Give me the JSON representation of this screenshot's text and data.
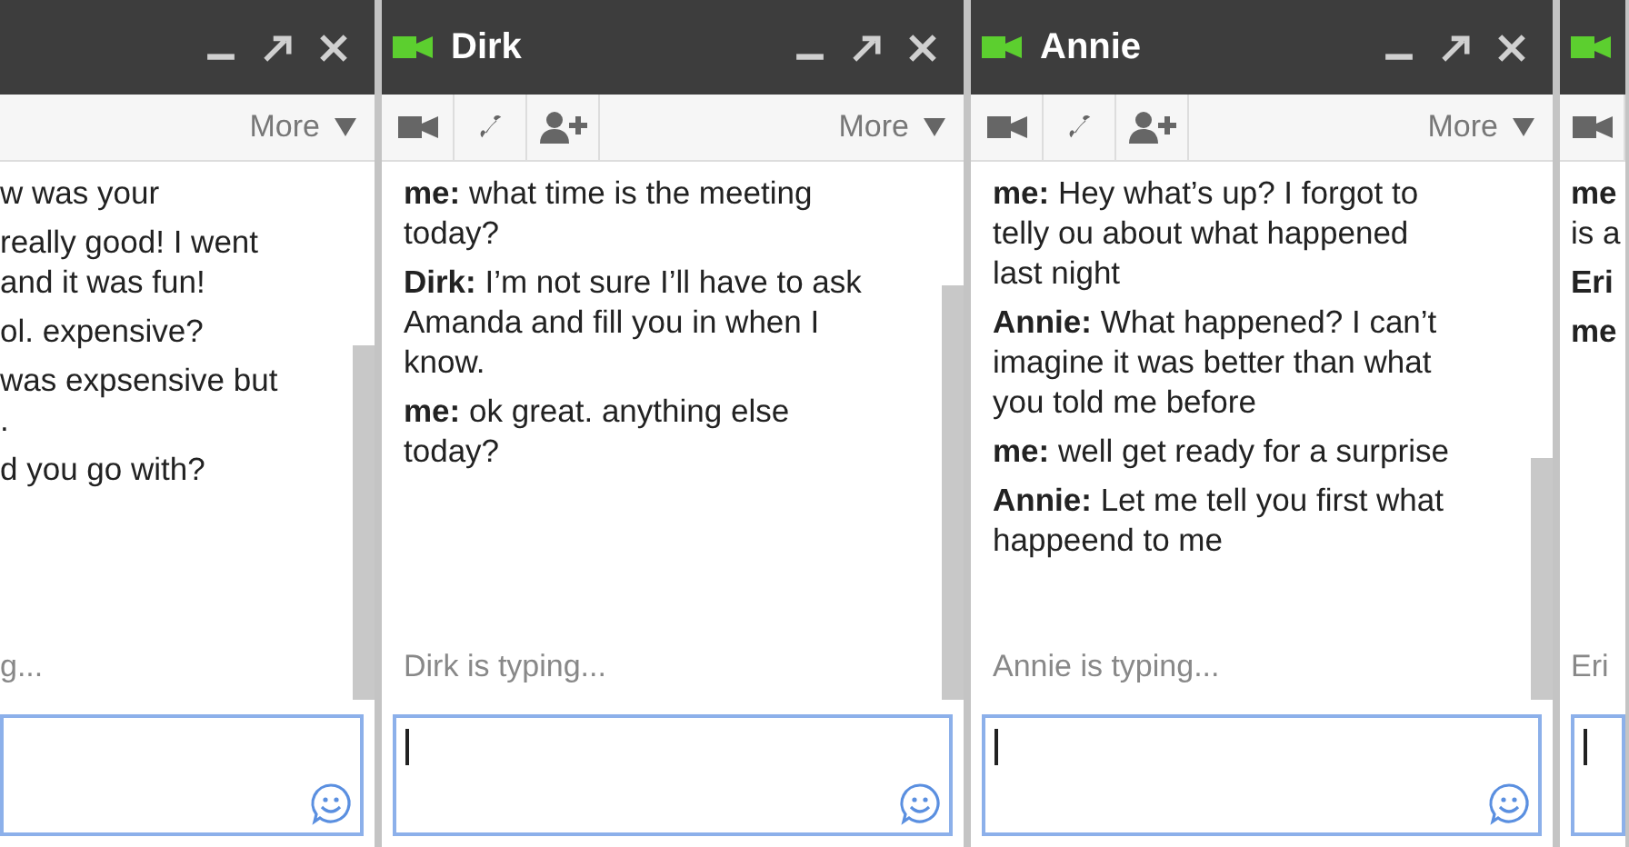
{
  "chat_windows": [
    {
      "more": "More",
      "messages": [
        {
          "lines": [
            "w was your"
          ]
        },
        {
          "lines": [
            "really good! I went",
            "and it was fun!"
          ]
        },
        {
          "lines": [
            "ol. expensive?"
          ]
        },
        {
          "lines": [
            "was expsensive but",
            "."
          ]
        },
        {
          "lines": [
            "d you go with?"
          ]
        }
      ],
      "typing": "g...",
      "emoji_button": true,
      "controls": true
    },
    {
      "camera_icon": true,
      "title": "Dirk",
      "buttons": [
        {
          "kind": "video"
        },
        {
          "kind": "phone"
        },
        {
          "kind": "add-person"
        }
      ],
      "more": "More",
      "messages": [
        {
          "sender": "me:",
          "text": "what time is the meeting today?"
        },
        {
          "sender": "Dirk:",
          "text": "I’m not sure I’ll have to ask Amanda and fill you in when I know."
        },
        {
          "sender": "me:",
          "text": "ok great. anything else today?"
        }
      ],
      "typing": "Dirk is typing...",
      "cursor": true,
      "emoji_button": true,
      "controls": true
    },
    {
      "camera_icon": true,
      "title": "Annie",
      "buttons": [
        {
          "kind": "video"
        },
        {
          "kind": "phone"
        },
        {
          "kind": "add-person"
        }
      ],
      "more": "More",
      "messages": [
        {
          "sender": "me:",
          "text": "Hey what’s up? I forgot to telly ou about what happened last night"
        },
        {
          "sender": "Annie:",
          "text": "What happened? I can’t imagine it was better than what you told me before"
        },
        {
          "sender": "me:",
          "text": "well get ready for a surprise"
        },
        {
          "sender": "Annie:",
          "text": "Let me tell you first what happeend to me"
        }
      ],
      "typing": "Annie is typing...",
      "cursor": true,
      "emoji_button": true,
      "controls": true
    },
    {
      "camera_icon": true,
      "buttons": [
        {
          "kind": "video"
        }
      ],
      "messages": [
        {
          "sender": "me",
          "lines": [
            "is a"
          ]
        },
        {
          "sender": "Eri"
        },
        {
          "sender": "me"
        }
      ],
      "typing": "Eri",
      "cursor": true
    }
  ]
}
